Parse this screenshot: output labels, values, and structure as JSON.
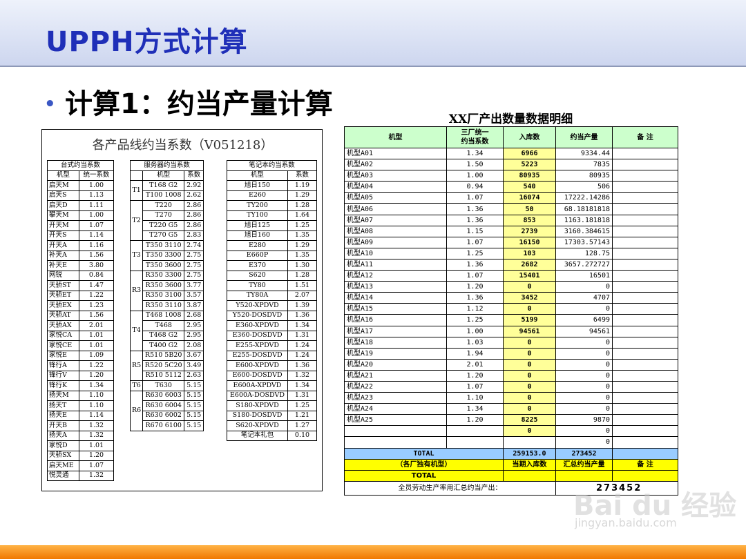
{
  "slide": {
    "title": "UPPH方式计算",
    "bullet": "计算1：约当产量计算"
  },
  "left_panel": {
    "title": "各产品线约当系数（V051218）",
    "desktop": {
      "caption": "台式约当系数",
      "headers": [
        "机型",
        "统一系数"
      ],
      "rows": [
        [
          "启天M",
          "1.00"
        ],
        [
          "启天S",
          "1.13"
        ],
        [
          "启天D",
          "1.11"
        ],
        [
          "攀天M",
          "1.00"
        ],
        [
          "开天M",
          "1.07"
        ],
        [
          "开天S",
          "1.14"
        ],
        [
          "开天A",
          "1.16"
        ],
        [
          "补天A",
          "1.56"
        ],
        [
          "补天E",
          "3.80"
        ],
        [
          "网锐",
          "0.84"
        ],
        [
          "天骄ST",
          "1.47"
        ],
        [
          "天骄ET",
          "1.22"
        ],
        [
          "天骄EX",
          "1.23"
        ],
        [
          "天骄AT",
          "1.56"
        ],
        [
          "天骄AX",
          "2.01"
        ],
        [
          "家悦CA",
          "1.01"
        ],
        [
          "家悦CE",
          "1.01"
        ],
        [
          "家悦E",
          "1.09"
        ],
        [
          "锋行A",
          "1.22"
        ],
        [
          "锋行V",
          "1.20"
        ],
        [
          "锋行K",
          "1.34"
        ],
        [
          "扬天M",
          "1.10"
        ],
        [
          "扬天T",
          "1.10"
        ],
        [
          "扬天E",
          "1.14"
        ],
        [
          "开天B",
          "1.32"
        ],
        [
          "扬天A",
          "1.32"
        ],
        [
          "家悦D",
          "1.01"
        ],
        [
          "天骄SX",
          "1.20"
        ],
        [
          "启天ME",
          "1.07"
        ],
        [
          "悦灵通",
          "1.32"
        ]
      ]
    },
    "server": {
      "caption": "服务器约当系数",
      "headers": [
        "机型",
        "系数"
      ],
      "groups": [
        {
          "group": "T1",
          "rows": [
            [
              "T168 G2",
              "2.92"
            ],
            [
              "T100 1008",
              "2.62"
            ]
          ]
        },
        {
          "group": "T2",
          "rows": [
            [
              "T220",
              "2.86"
            ],
            [
              "T270",
              "2.86"
            ],
            [
              "T220 G5",
              "2.86"
            ],
            [
              "T270 G5",
              "2.83"
            ]
          ]
        },
        {
          "group": "T3",
          "rows": [
            [
              "T350 3110",
              "2.74"
            ],
            [
              "T350 3300",
              "2.75"
            ],
            [
              "T350 3600",
              "2.75"
            ]
          ]
        },
        {
          "group": "R3",
          "rows": [
            [
              "R350 3300",
              "2.75"
            ],
            [
              "R350 3600",
              "3.77"
            ],
            [
              "R350 3100",
              "3.57"
            ],
            [
              "R350 3110",
              "3.87"
            ]
          ]
        },
        {
          "group": "T4",
          "rows": [
            [
              "T468 1008",
              "2.68"
            ],
            [
              "T468",
              "2.95"
            ],
            [
              "T468 G2",
              "2.95"
            ],
            [
              "T400 G2",
              "2.08"
            ]
          ]
        },
        {
          "group": "R5",
          "rows": [
            [
              "R510 5B20",
              "3.67"
            ],
            [
              "R520 5C20",
              "3.49"
            ],
            [
              "R510 5112",
              "2.63"
            ]
          ]
        },
        {
          "group": "T6",
          "rows": [
            [
              "T630",
              "5.15"
            ]
          ]
        },
        {
          "group": "R6",
          "rows": [
            [
              "R630 6003",
              "5.15"
            ],
            [
              "R630 6004",
              "5.15"
            ],
            [
              "R630 6002",
              "5.15"
            ],
            [
              "R670 6100",
              "5.15"
            ]
          ]
        }
      ]
    },
    "notebook": {
      "caption": "笔记本约当系数",
      "headers": [
        "机型",
        "系数"
      ],
      "rows": [
        [
          "旭日150",
          "1.19"
        ],
        [
          "E260",
          "1.29"
        ],
        [
          "TY200",
          "1.28"
        ],
        [
          "TY100",
          "1.64"
        ],
        [
          "旭日125",
          "1.25"
        ],
        [
          "旭日160",
          "1.35"
        ],
        [
          "E280",
          "1.29"
        ],
        [
          "E660P",
          "1.35"
        ],
        [
          "E370",
          "1.30"
        ],
        [
          "S620",
          "1.28"
        ],
        [
          "TY80",
          "1.51"
        ],
        [
          "TY80A",
          "2.07"
        ],
        [
          "Y520-XPDVD",
          "1.39"
        ],
        [
          "Y520-DOSDVD",
          "1.36"
        ],
        [
          "E360-XPDVD",
          "1.34"
        ],
        [
          "E360-DOSDVD",
          "1.31"
        ],
        [
          "E255-XPDVD",
          "1.24"
        ],
        [
          "E255-DOSDVD",
          "1.24"
        ],
        [
          "E600-XPDVD",
          "1.36"
        ],
        [
          "E600-DOSDVD",
          "1.32"
        ],
        [
          "E600A-XPDVD",
          "1.34"
        ],
        [
          "E600A-DOSDVD",
          "1.31"
        ],
        [
          "S180-XPDVD",
          "1.25"
        ],
        [
          "S180-DOSDVD",
          "1.21"
        ],
        [
          "S620-XPDVD",
          "1.27"
        ],
        [
          "笔记本礼包",
          "0.10"
        ]
      ]
    }
  },
  "right_panel": {
    "title": "XX厂产出数量数据明细",
    "headers": [
      "机型",
      "三厂统一\n约当系数",
      "入库数",
      "约当产量",
      "备 注"
    ],
    "rows": [
      [
        "机型A01",
        "1.34",
        "6966",
        "9334.44"
      ],
      [
        "机型A02",
        "1.50",
        "5223",
        "7835"
      ],
      [
        "机型A03",
        "1.00",
        "80935",
        "80935"
      ],
      [
        "机型A04",
        "0.94",
        "540",
        "506"
      ],
      [
        "机型A05",
        "1.07",
        "16074",
        "17222.14286"
      ],
      [
        "机型A06",
        "1.36",
        "50",
        "68.18181818"
      ],
      [
        "机型A07",
        "1.36",
        "853",
        "1163.181818"
      ],
      [
        "机型A08",
        "1.15",
        "2739",
        "3160.384615"
      ],
      [
        "机型A09",
        "1.07",
        "16150",
        "17303.57143"
      ],
      [
        "机型A10",
        "1.25",
        "103",
        "128.75"
      ],
      [
        "机型A11",
        "1.36",
        "2682",
        "3657.272727"
      ],
      [
        "机型A12",
        "1.07",
        "15401",
        "16501"
      ],
      [
        "机型A13",
        "1.20",
        "0",
        "0"
      ],
      [
        "机型A14",
        "1.36",
        "3452",
        "4707"
      ],
      [
        "机型A15",
        "1.12",
        "0",
        "0"
      ],
      [
        "机型A16",
        "1.25",
        "5199",
        "6499"
      ],
      [
        "机型A17",
        "1.00",
        "94561",
        "94561"
      ],
      [
        "机型A18",
        "1.03",
        "0",
        "0"
      ],
      [
        "机型A19",
        "1.94",
        "0",
        "0"
      ],
      [
        "机型A20",
        "2.01",
        "0",
        "0"
      ],
      [
        "机型A21",
        "1.20",
        "0",
        "0"
      ],
      [
        "机型A22",
        "1.07",
        "0",
        "0"
      ],
      [
        "机型A23",
        "1.10",
        "0",
        "0"
      ],
      [
        "机型A24",
        "1.34",
        "0",
        "0"
      ],
      [
        "机型A25",
        "1.20",
        "8225",
        "9870"
      ],
      [
        "",
        "",
        "0",
        "0"
      ],
      [
        "",
        "",
        "",
        "0"
      ]
    ],
    "total_row": {
      "label": "TOTAL",
      "in_stock": "259153.0",
      "equiv": "273452"
    },
    "exclusive_row": {
      "label": "（各厂独有机型）",
      "in_stock": "当期入库数",
      "equiv": "汇总约当产量",
      "note": "备 注"
    },
    "total_row2": {
      "label": "TOTAL"
    },
    "footer": {
      "label": "全员劳动生产率用汇总约当产出：",
      "value": "273452"
    }
  },
  "watermark": {
    "text": "Bai du 经验",
    "sub": "jingyan.baidu.com"
  },
  "colors": {
    "title": "#1f2fb8",
    "header_green": "#ccffcc",
    "cell_yellow": "#ffff99",
    "total_blue": "#99ccff",
    "row_yellow": "#ffff00",
    "bottom_orange": "#f07800"
  }
}
